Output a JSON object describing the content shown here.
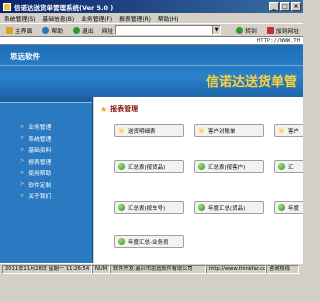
{
  "window": {
    "title": "信诺达送货单管理系统(Ver 5.0 )",
    "controls": [
      "_",
      "□",
      "×"
    ]
  },
  "menu": [
    "系统管理(S)",
    "基础信息(B)",
    "业务管理(F)",
    "报表管理(R)",
    "帮助(H)"
  ],
  "toolbar": {
    "home": "主界面",
    "help": "帮助",
    "exit": "退出",
    "address_label": "网址",
    "goto": "转到",
    "favorites": "加到网址"
  },
  "url_text": "HTTP://WWW.TH",
  "header": {
    "brand": "思远软件",
    "title": "信诺达送货单管"
  },
  "sidebar": {
    "items": [
      "业务管理",
      "系统管理",
      "基础资料",
      "报表管理",
      "使用帮助",
      "软件定制",
      "关于我们"
    ]
  },
  "main": {
    "section_title": "报表管理",
    "buttons": [
      "送货明细表",
      "客户对账单",
      "客户",
      "汇总表(按货品)",
      "汇总表(按客户)",
      "汇",
      "汇总表(按车号)",
      "年度汇总(货品)",
      "年度",
      "年度汇总-业务员"
    ]
  },
  "status": {
    "date": "2011年11月28日 星期一 11:26:54",
    "num": "NUM",
    "dev": "软件开发:嘉兴市思远软件有限公司",
    "site": "http://www.thinkfar.com",
    "phone": "咨询热线"
  }
}
